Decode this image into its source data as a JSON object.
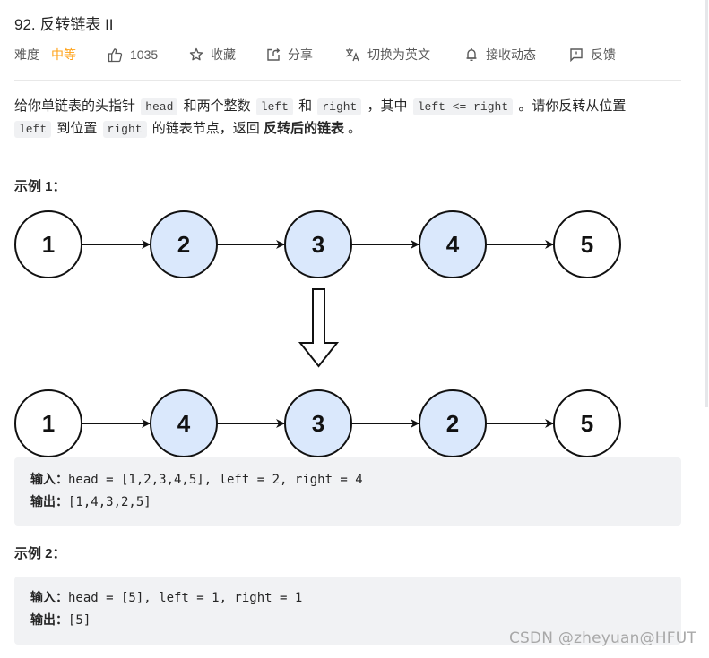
{
  "problem": {
    "title": "92. 反转链表 II"
  },
  "toolbar": {
    "difficulty_label": "难度",
    "difficulty_value": "中等",
    "difficulty_color": "#ffa116",
    "likes": "1035",
    "favorite_label": "收藏",
    "share_label": "分享",
    "translate_label": "切换为英文",
    "subscribe_label": "接收动态",
    "feedback_label": "反馈",
    "icons": {
      "like": "thumbs-up-icon",
      "favorite": "star-icon",
      "share": "share-icon",
      "translate": "translate-icon",
      "subscribe": "bell-icon",
      "feedback": "feedback-icon"
    }
  },
  "description": {
    "line1": {
      "t1": "给你单链表的头指针",
      "c1": "head",
      "t2": "和两个整数",
      "c2": "left",
      "t3": "和",
      "c3": "right",
      "t4": "，其中",
      "c4": "left <= right",
      "t5": "。请你反转从位置"
    },
    "line2": {
      "c1": "left",
      "t1": "到位置",
      "c2": "right",
      "t2": "的链表节点，返回",
      "bold": "反转后的链表",
      "t3": "。"
    }
  },
  "examples": [
    {
      "title": "示例 1：",
      "diagram": {
        "before": [
          {
            "value": "1",
            "highlighted": false
          },
          {
            "value": "2",
            "highlighted": true
          },
          {
            "value": "3",
            "highlighted": true
          },
          {
            "value": "4",
            "highlighted": true
          },
          {
            "value": "5",
            "highlighted": false
          }
        ],
        "after": [
          {
            "value": "1",
            "highlighted": false
          },
          {
            "value": "4",
            "highlighted": true
          },
          {
            "value": "3",
            "highlighted": true
          },
          {
            "value": "2",
            "highlighted": true
          },
          {
            "value": "5",
            "highlighted": false
          }
        ],
        "highlight_color": "#dae8fc"
      },
      "input_label": "输入：",
      "input": "head = [1,2,3,4,5], left = 2, right = 4",
      "output_label": "输出：",
      "output": "[1,4,3,2,5]"
    },
    {
      "title": "示例 2：",
      "input_label": "输入：",
      "input": "head = [5], left = 1, right = 1",
      "output_label": "输出：",
      "output": "[5]"
    }
  ],
  "watermark": "CSDN @zheyuan@HFUT"
}
